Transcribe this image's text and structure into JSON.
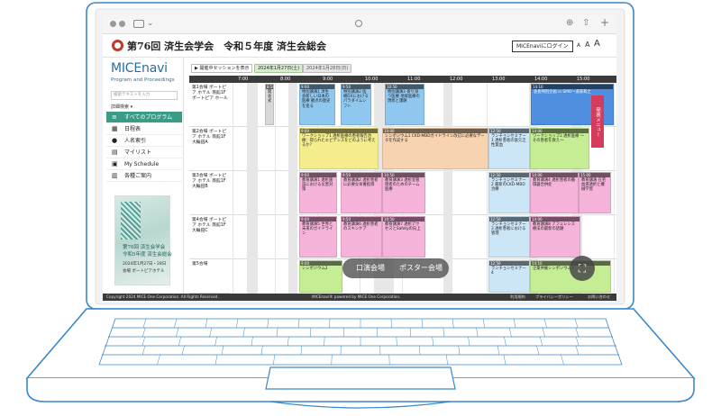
{
  "browser": {
    "icons": [
      "sidebar-icon",
      "chevron-down-icon",
      "camera-icon",
      "download-icon",
      "share-icon",
      "plus-icon"
    ]
  },
  "header": {
    "title": "第76回 済生会学会　令和５年度 済生会総会",
    "login_label": "MICEnaviにログイン",
    "font_sizes": [
      "A",
      "A",
      "A"
    ]
  },
  "sidebar": {
    "brand": "MICEnavi",
    "brand_sub": "Program and Proceedings",
    "search_placeholder": "検索テキストを入力",
    "advanced_search": "詳細検索 ▾",
    "menu": [
      {
        "label": "すべてのプログラム",
        "icon": "list-icon",
        "active": true
      },
      {
        "label": "日程表",
        "icon": "calendar-icon"
      },
      {
        "label": "人名索引",
        "icon": "person-icon"
      },
      {
        "label": "マイリスト",
        "icon": "document-icon"
      },
      {
        "label": "My Schedule",
        "icon": "calendar-check-icon"
      },
      {
        "label": "各種ご案内",
        "icon": "building-icon"
      }
    ],
    "banner": {
      "line1": "第76回 済生会学会",
      "line2": "令和5年度 済生会総会",
      "line3": "2024年1月27日・28日",
      "line4": "会場 ポートピアホテル"
    }
  },
  "toolbar": {
    "show_sessions": "開催中セッションを表示",
    "day1": "2024年1月27日(土)",
    "day2": "2024年1月28日(日)"
  },
  "timeline": {
    "hours": [
      "7:00",
      "8:00",
      "9:00",
      "10:00",
      "11:00",
      "12:00",
      "13:00",
      "14:00",
      "15:00"
    ]
  },
  "rooms": [
    {
      "name": "第1会場 ポートピア ホテル 南館1F ポートピア ホール"
    },
    {
      "name": "第2会場 ポートピア ホテル 南館1F 大輪田A"
    },
    {
      "name": "第3会場 ポートピア ホテル 南館1F 大輪田B"
    },
    {
      "name": "第4会場 ポートピア ホテル 南館1F 大輪田C"
    },
    {
      "name": "第5会場"
    }
  ],
  "sessions": [
    {
      "time": "8:50",
      "title": "開会式",
      "color": "gray"
    },
    {
      "time": "9:00",
      "title": "特別講演1 済生会新しい日本の医療 観点の歴史を巡る",
      "color": "blue"
    },
    {
      "time": "9:50",
      "title": "特別講演2 医療DXにおけるパラダイムシフト",
      "color": "blue"
    },
    {
      "time": "10:50",
      "title": "特別講演3 寄り添う医療 地域医療の現状と課題",
      "color": "blue"
    },
    {
      "time": "14:10",
      "title": "会長特別企画 in SMO～道家和之",
      "color": "ro"
    },
    {
      "time": "9:00",
      "title": "ワークショップ1 透析医療の患者報告治療：得られたエビデンスをどのように考えるか？",
      "color": "yellow"
    },
    {
      "time": "10:00",
      "title": "シンポジウム1 CKD-MBDガイドライン改訂に必要なデータを作成する",
      "color": "peach"
    },
    {
      "time": "12:50",
      "title": "ランチョンセミナー1 透析患者の鉄欠乏性貧血",
      "color": "lblue"
    },
    {
      "time": "14:00",
      "title": "ワークショップ2 透析医療 ～その患者を救え～",
      "color": "green"
    },
    {
      "time": "9:00",
      "title": "教育講演1 透析施設における災害対策",
      "color": "pink"
    },
    {
      "time": "9:50",
      "title": "教育講演2 透析患者に必要な栄養指導",
      "color": "pink"
    },
    {
      "time": "10:50",
      "title": "教育講演3 透析室管理者のためのチーム医療",
      "color": "pink"
    },
    {
      "time": "12:50",
      "title": "ランチョンセミナー2 最新のCKD-MBD治療",
      "color": "lblue"
    },
    {
      "time": "14:00",
      "title": "教育講演4 透析患者の循環器合併症",
      "color": "pink"
    },
    {
      "time": "15:00",
      "title": "教育講演 在宅血液透析と機械学習",
      "color": "pink"
    },
    {
      "time": "9:00",
      "title": "教育講演5 世界と未来のガイドライン",
      "color": "pink"
    },
    {
      "time": "9:50",
      "title": "教育講演6 透析患者のスキンケア",
      "color": "pink"
    },
    {
      "time": "10:50",
      "title": "教育講演7 透析アクセスとSafetyの向上",
      "color": "pink"
    },
    {
      "time": "12:50",
      "title": "ランチョンセミナー3 透析患者における管理",
      "color": "lblue"
    },
    {
      "time": "14:00",
      "title": "教育講演8 アフェレシス療法の最新の話題",
      "color": "pink"
    },
    {
      "time": "9:00",
      "title": "シンポジウム2",
      "color": "green"
    },
    {
      "time": "12:50",
      "title": "ランチョンセミナー4",
      "color": "lblue"
    },
    {
      "time": "14:10",
      "title": "企業共催シンポジウム1",
      "color": "green"
    }
  ],
  "float_tab": "発表メニュー",
  "venue_toggle": {
    "oral": "口演会場",
    "poster": "ポスター会場"
  },
  "expand_icon": "expand-icon",
  "footer": {
    "copyright": "Copyright 2024 MICE One Corporation. All Rights Reserved.",
    "powered": "MICEnavi® powered by MICE One Corporation.",
    "terms": "利用規約",
    "privacy": "プライバシーポリシー",
    "contact": "お問い合わせ"
  }
}
